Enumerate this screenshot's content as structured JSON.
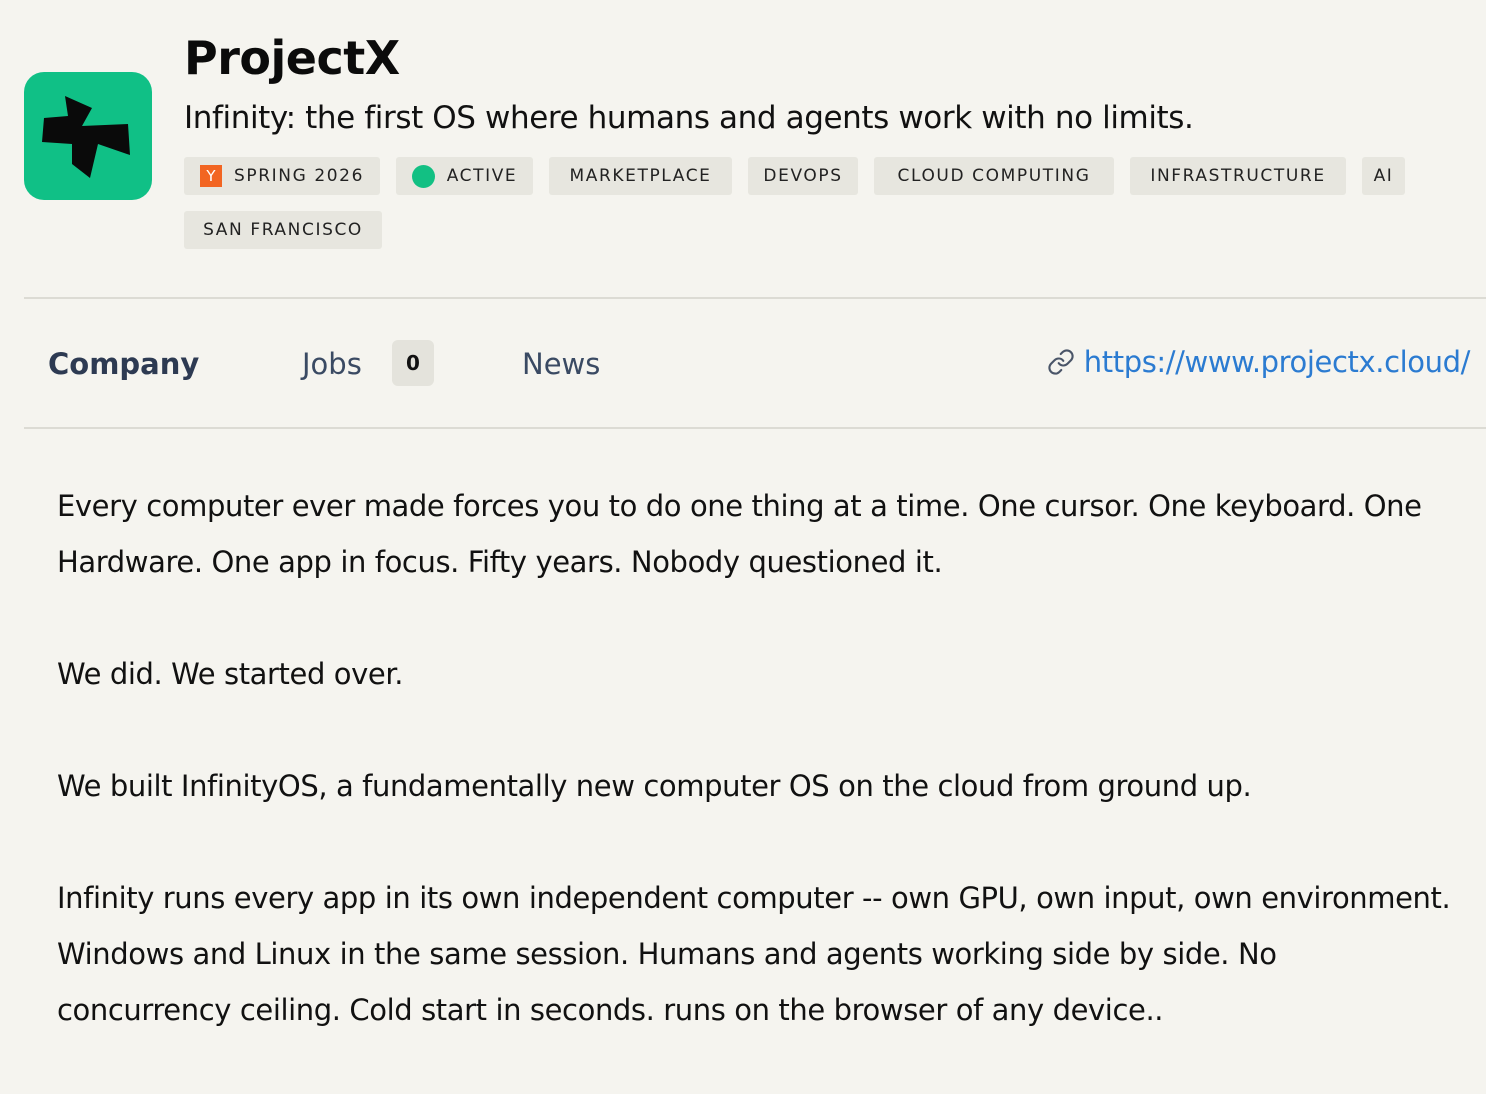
{
  "company": {
    "name": "ProjectX",
    "tagline": "Infinity: the first OS where humans and agents work with no limits.",
    "logo_color": "#10c086"
  },
  "tags": {
    "batch": {
      "icon": "Y",
      "label": "SPRING 2026"
    },
    "status": {
      "label": "ACTIVE",
      "dot_color": "#12c083"
    },
    "industries": [
      "MARKETPLACE",
      "DEVOPS",
      "CLOUD COMPUTING",
      "INFRASTRUCTURE",
      "AI"
    ],
    "location": "SAN FRANCISCO"
  },
  "tabs": {
    "company": "Company",
    "jobs": "Jobs",
    "jobs_count": "0",
    "news": "News"
  },
  "website": {
    "url": "https://www.projectx.cloud/",
    "icon": "link-icon"
  },
  "description": [
    "Every computer ever made forces you to do one thing at a time. One cursor. One keyboard. One Hardware. One app in focus. Fifty years. Nobody questioned it.",
    "We did. We started over.",
    "We built InfinityOS, a fundamentally new computer OS on the cloud from ground up.",
    "Infinity runs every app in its own independent computer -- own GPU, own input, own environment. Windows and Linux in the same session. Humans and agents working side by side. No concurrency ceiling. Cold start in seconds. runs on the browser of any device.."
  ]
}
